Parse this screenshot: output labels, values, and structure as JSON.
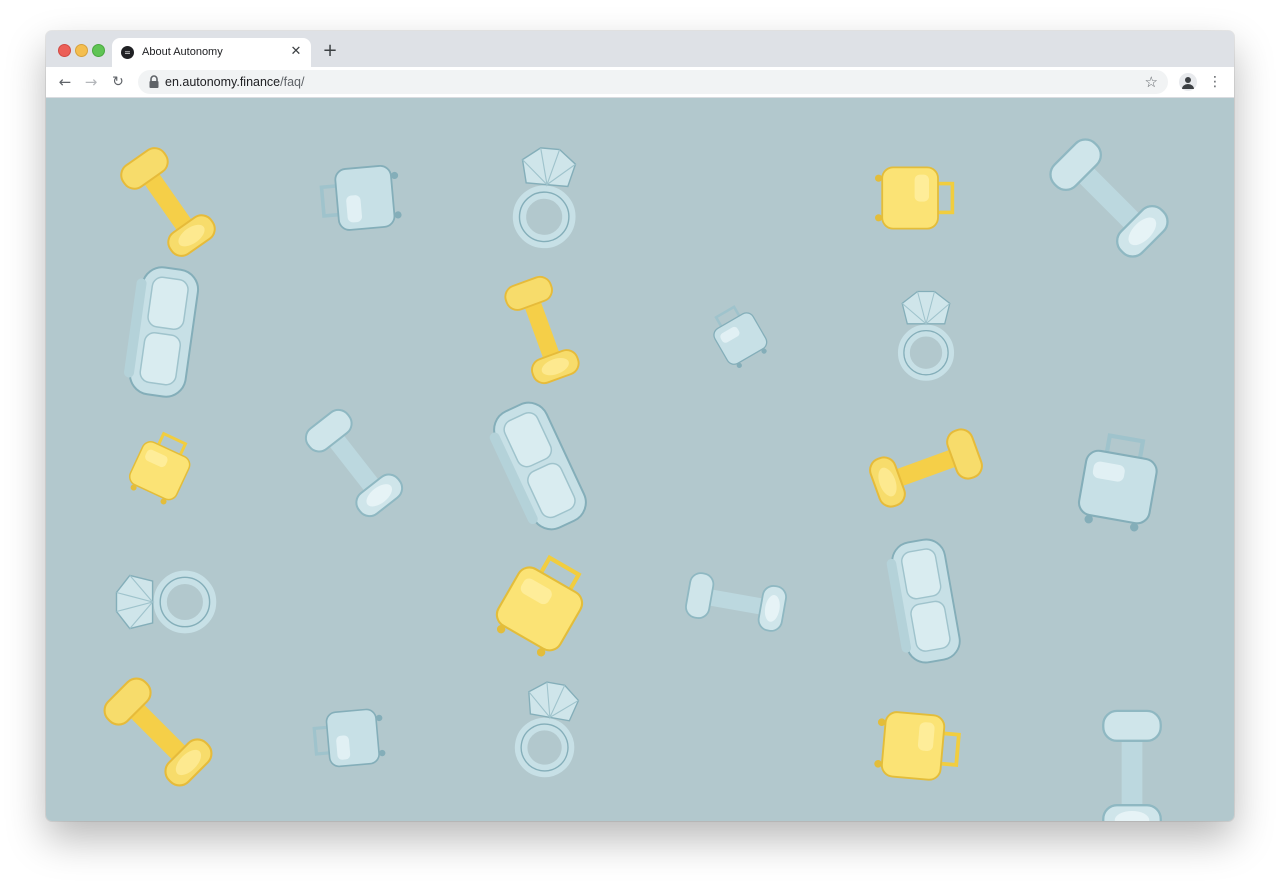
{
  "browser": {
    "tab": {
      "title": "About Autonomy",
      "favicon_glyph": "=",
      "close_glyph": "✕"
    },
    "new_tab_glyph": "+",
    "nav": {
      "back_glyph": "←",
      "forward_glyph": "→",
      "reload_glyph": "↻"
    },
    "address": {
      "host": "en.autonomy.finance",
      "path": "/faq/"
    },
    "bookmark_glyph": "☆",
    "menu_glyph": "⋮"
  },
  "page": {
    "background_color": "#b2c8cd",
    "object_colors": {
      "yellow": "#f7dc6b",
      "blue": "#c7e0e6"
    }
  }
}
